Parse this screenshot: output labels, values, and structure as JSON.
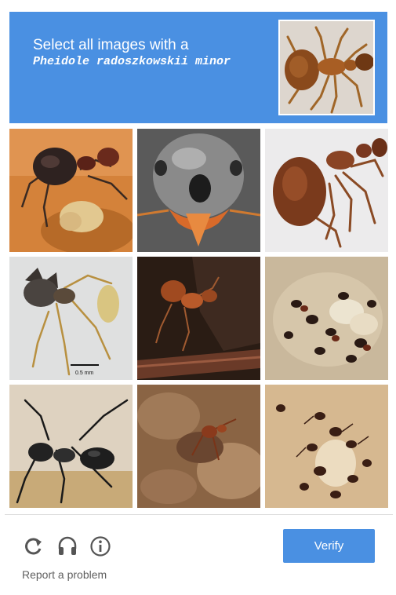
{
  "header": {
    "instruction": "Select all images with a",
    "target": "Pheidole radoszkowskii minor",
    "background_color": "#4a90e2",
    "sample_image": "ant-sample-closeup"
  },
  "grid": {
    "tiles": [
      {
        "subject": "large-headed-ant-on-debris"
      },
      {
        "subject": "ant-head-frontal-closeup"
      },
      {
        "subject": "major-worker-ant-side-view"
      },
      {
        "subject": "spiny-ant-specimen",
        "scale_text": "0.5 mm"
      },
      {
        "subject": "ant-on-dark-twig"
      },
      {
        "subject": "ant-colony-with-brood"
      },
      {
        "subject": "black-long-legged-ant"
      },
      {
        "subject": "ant-on-rough-bark"
      },
      {
        "subject": "ant-cluster-on-larva"
      }
    ]
  },
  "controls": {
    "reload_icon": "reload-icon",
    "audio_icon": "headphones-icon",
    "info_icon": "info-icon",
    "verify_label": "Verify",
    "verify_color": "#4a90e2",
    "report_label": "Report a problem"
  }
}
